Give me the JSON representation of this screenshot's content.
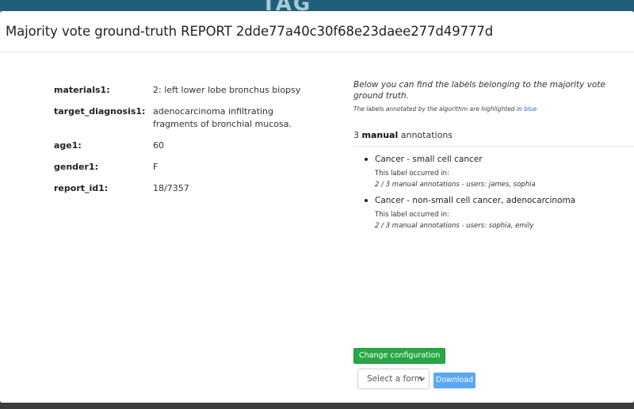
{
  "backdrop": {
    "logo_left": "TAG"
  },
  "modal": {
    "title": "Majority vote ground-truth REPORT 2dde77a40c30f68e23daee277d49777d"
  },
  "report_fields": [
    {
      "key": "materials1:",
      "value": "2: left lower lobe bronchus biopsy"
    },
    {
      "key": "target_diagnosis1:",
      "value": "adenocarcinoma infiltrating fragments of bronchial mucosa."
    },
    {
      "key": "age1:",
      "value": "60"
    },
    {
      "key": "gender1:",
      "value": "F"
    },
    {
      "key": "report_id1:",
      "value": "18/7357"
    }
  ],
  "annotations_panel": {
    "intro": "Below you can find the labels belonging to the majority vote ground truth.",
    "intro_sub_prefix": "The labels annotated by the algorithm are highlighted in ",
    "intro_sub_highlight": "blue",
    "count": "3",
    "count_bold": "manual",
    "count_suffix": "annotations",
    "labels": [
      {
        "name": "Cancer - small cell cancer",
        "occurred": "This label occurred in:",
        "users": "2 / 3 manual annotations - users: james, sophia"
      },
      {
        "name": "Cancer - non-small cell cancer, adenocarcinoma",
        "occurred": "This label occurred in:",
        "users": "2 / 3 manual annotations - users: sophia, emily"
      }
    ]
  },
  "actions": {
    "change_config_label": "Change configuration",
    "select_form_value": "Select a form",
    "download_label": "Download"
  },
  "colors": {
    "green_button": "#28a745",
    "download_button": "#5aa8f2",
    "highlight_blue": "#2b6fd6"
  }
}
